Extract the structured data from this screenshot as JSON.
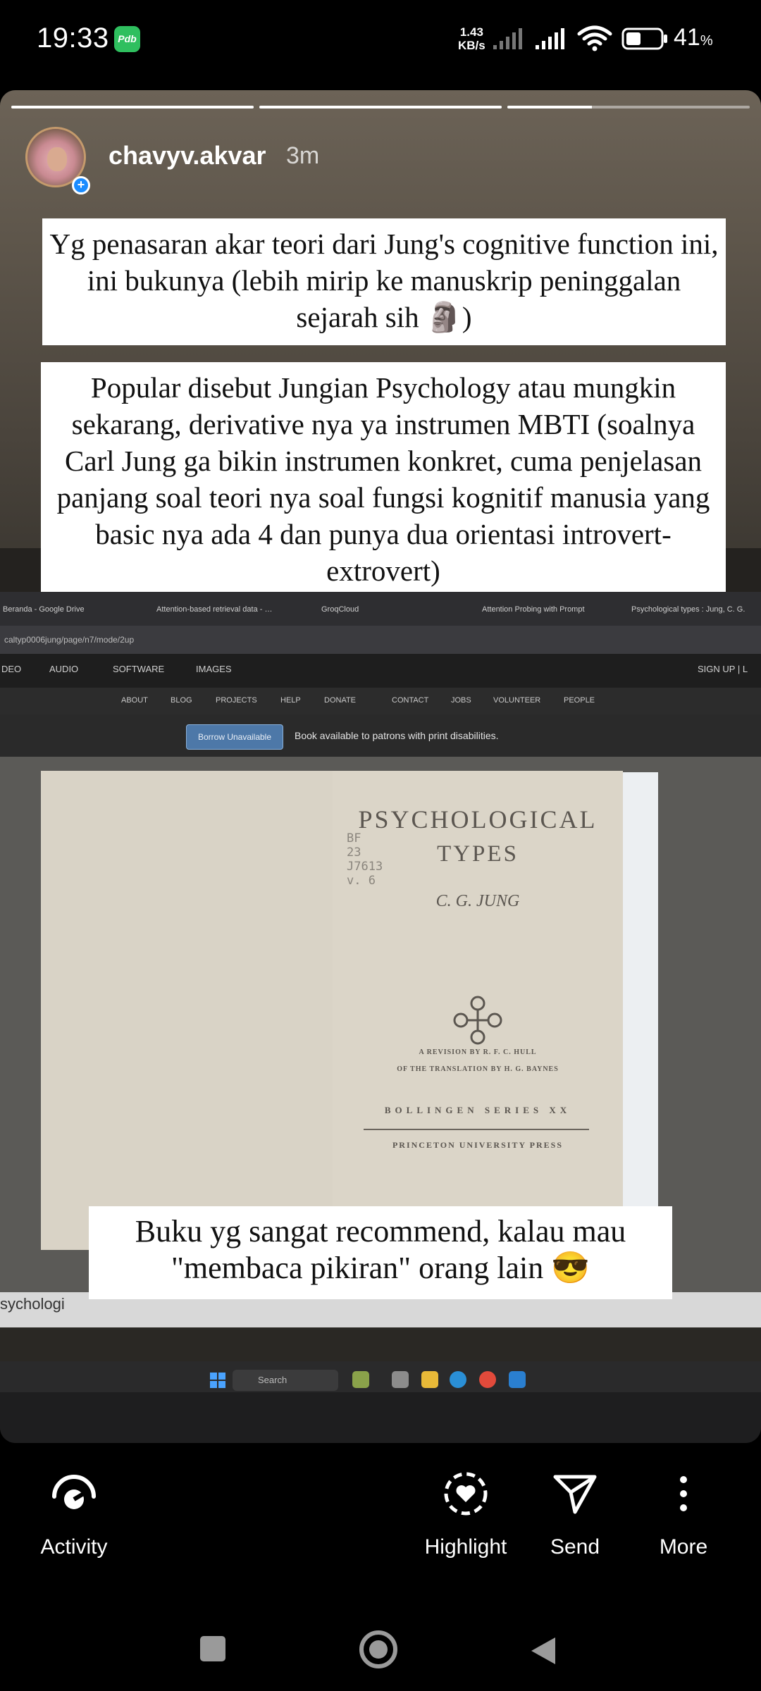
{
  "status_bar": {
    "time": "19:33",
    "notification_app": "Pdb",
    "net_speed_value": "1.43",
    "net_speed_unit": "KB/s",
    "battery_percent": "41",
    "battery_unit": "%"
  },
  "story": {
    "progress_segments": [
      1.0,
      1.0,
      0.35
    ],
    "username": "chavyv.akvar",
    "time_ago": "3m",
    "captions": [
      "Yg penasaran akar teori dari Jung's cognitive function ini, ini bukunya (lebih mirip ke manuskrip peninggalan sejarah sih 🗿)",
      "Popular disebut Jungian Psychology atau mungkin sekarang, derivative nya ya instrumen MBTI (soalnya Carl Jung ga bikin instrumen konkret, cuma penjelasan panjang soal teori nya soal fungsi kognitif manusia yang basic nya ada 4 dan punya dua orientasi introvert-extrovert)",
      "Buku yg sangat recommend, kalau mau \"membaca pikiran\" orang lain 😎"
    ]
  },
  "photo": {
    "browser_tabs": [
      "Beranda - Google Drive",
      "Attention-based retrieval data - …",
      "GroqCloud",
      "Attention Probing with Prompt",
      "Psychological types : Jung, C. G."
    ],
    "url": "caltyp0006jung/page/n7/mode/2up",
    "media_nav": [
      "DEO",
      "AUDIO",
      "SOFTWARE",
      "IMAGES"
    ],
    "sign_up": "SIGN UP | L",
    "site_nav": [
      "ABOUT",
      "BLOG",
      "PROJECTS",
      "HELP",
      "DONATE",
      "CONTACT",
      "JOBS",
      "VOLUNTEER",
      "PEOPLE"
    ],
    "borrow_button": "Borrow Unavailable",
    "borrow_note": "Book available to patrons with print disabilities.",
    "book": {
      "title_line1": "PSYCHOLOGICAL",
      "title_line2": "TYPES",
      "author": "C. G. JUNG",
      "pencil_note": "BF\n23\nJ7613\nv. 6",
      "revision_line1": "A REVISION BY R. F. C. HULL",
      "revision_line2": "OF THE TRANSLATION BY H. G. BAYNES",
      "series": "BOLLINGEN SERIES XX",
      "publisher": "PRINCETON UNIVERSITY PRESS"
    },
    "footer_title": "sychologi",
    "taskbar_search": "Search"
  },
  "actions": {
    "activity": "Activity",
    "highlight": "Highlight",
    "send": "Send",
    "more": "More"
  }
}
